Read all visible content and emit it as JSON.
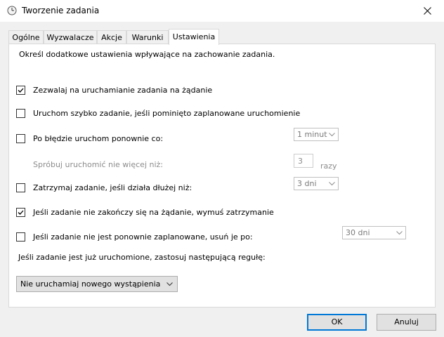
{
  "window": {
    "title": "Tworzenie zadania"
  },
  "tabs": [
    {
      "label": "Ogólne"
    },
    {
      "label": "Wyzwalacze"
    },
    {
      "label": "Akcje"
    },
    {
      "label": "Warunki"
    },
    {
      "label": "Ustawienia",
      "active": true
    }
  ],
  "settings": {
    "intro": "Określ dodatkowe ustawienia wpływające na zachowanie zadania.",
    "allow_on_demand": {
      "label": "Zezwalaj na uruchamianie zadania na żądanie",
      "checked": true
    },
    "run_asap": {
      "label": "Uruchom szybko zadanie, jeśli pominięto zaplanowane uruchomienie",
      "checked": false
    },
    "restart_on_fail": {
      "label": "Po błędzie uruchom ponownie co:",
      "checked": false,
      "interval": "1 minut"
    },
    "retry": {
      "label": "Spróbuj uruchomić nie więcej niż:",
      "count": "3",
      "unit": "razy"
    },
    "stop_if_longer": {
      "label": "Zatrzymaj zadanie, jeśli działa dłużej niż:",
      "checked": false,
      "duration": "3 dni"
    },
    "force_stop": {
      "label": "Jeśli zadanie nie zakończy się na żądanie, wymuś zatrzymanie",
      "checked": true
    },
    "delete_if_not_scheduled": {
      "label": "Jeśli zadanie nie jest ponownie zaplanowane, usuń je po:",
      "checked": false,
      "after": "30 dni"
    },
    "rule_label": "Jeśli zadanie jest już uruchomione, zastosuj następującą regułę:",
    "rule_value": "Nie uruchamiaj nowego wystąpienia"
  },
  "buttons": {
    "ok": "OK",
    "cancel": "Anuluj"
  },
  "colors": {
    "focus_border": "#0078d7",
    "panel_bg": "#ffffff",
    "dialog_bg": "#f0f0f0"
  }
}
